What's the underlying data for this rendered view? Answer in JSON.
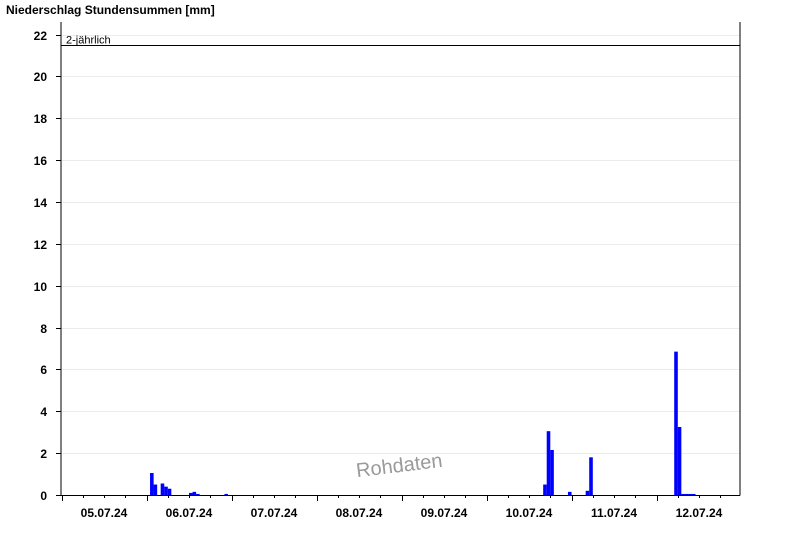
{
  "chart_data": {
    "type": "bar",
    "title": "Niederschlag Stundensummen [mm]",
    "xlabel": "",
    "ylabel": "",
    "ylim": [
      0,
      22.6
    ],
    "yticks": [
      0,
      2,
      4,
      6,
      8,
      10,
      12,
      14,
      16,
      18,
      20,
      22
    ],
    "x_day_start_labels": [
      "05.07.24",
      "06.07.24",
      "07.07.24",
      "08.07.24",
      "09.07.24",
      "10.07.24",
      "11.07.24",
      "12.07.24"
    ],
    "grid": true,
    "bar_color": "#0000ff",
    "threshold": {
      "label": "2-jährlich",
      "value": 21.5
    },
    "watermark": "Rohdaten",
    "bars": [
      {
        "t": "06.07.24 01:00",
        "v": 1.05
      },
      {
        "t": "06.07.24 02:00",
        "v": 0.5
      },
      {
        "t": "06.07.24 04:00",
        "v": 0.55
      },
      {
        "t": "06.07.24 05:00",
        "v": 0.4
      },
      {
        "t": "06.07.24 06:00",
        "v": 0.3
      },
      {
        "t": "06.07.24 12:00",
        "v": 0.1
      },
      {
        "t": "06.07.24 13:00",
        "v": 0.15
      },
      {
        "t": "06.07.24 14:00",
        "v": 0.05
      },
      {
        "t": "06.07.24 22:00",
        "v": 0.05
      },
      {
        "t": "10.07.24 16:00",
        "v": 0.5
      },
      {
        "t": "10.07.24 17:00",
        "v": 3.05
      },
      {
        "t": "10.07.24 18:00",
        "v": 2.15
      },
      {
        "t": "10.07.24 23:00",
        "v": 0.15
      },
      {
        "t": "11.07.24 04:00",
        "v": 0.2
      },
      {
        "t": "11.07.24 05:00",
        "v": 1.8
      },
      {
        "t": "12.07.24 05:00",
        "v": 6.85
      },
      {
        "t": "12.07.24 06:00",
        "v": 3.25
      },
      {
        "t": "12.07.24 07:00",
        "v": 0.05
      },
      {
        "t": "12.07.24 08:00",
        "v": 0.05
      },
      {
        "t": "12.07.24 09:00",
        "v": 0.05
      },
      {
        "t": "12.07.24 10:00",
        "v": 0.05
      }
    ]
  }
}
